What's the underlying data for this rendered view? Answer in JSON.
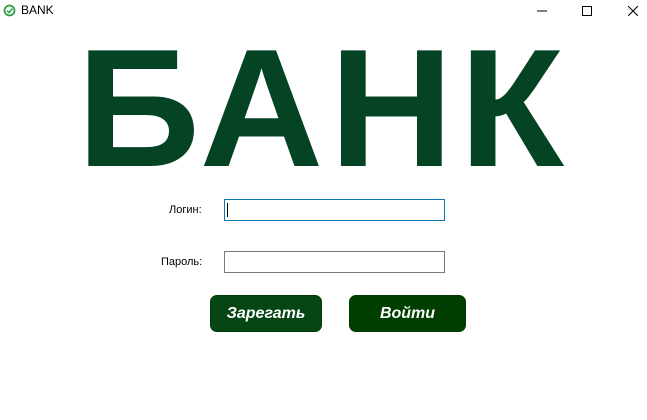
{
  "window": {
    "title": "BANK",
    "app_icon": "refresh-check-icon",
    "controls": {
      "minimize_icon": "minimize-icon",
      "maximize_icon": "maximize-icon",
      "close_icon": "close-icon"
    }
  },
  "main": {
    "heading": "БАНК",
    "heading_color": "#044425",
    "login_label": "Логин:",
    "login_value": "",
    "password_label": "Пароль:",
    "password_value": "",
    "register_button": "Зарегать",
    "login_button": "Войти",
    "button_color": "#064614"
  }
}
